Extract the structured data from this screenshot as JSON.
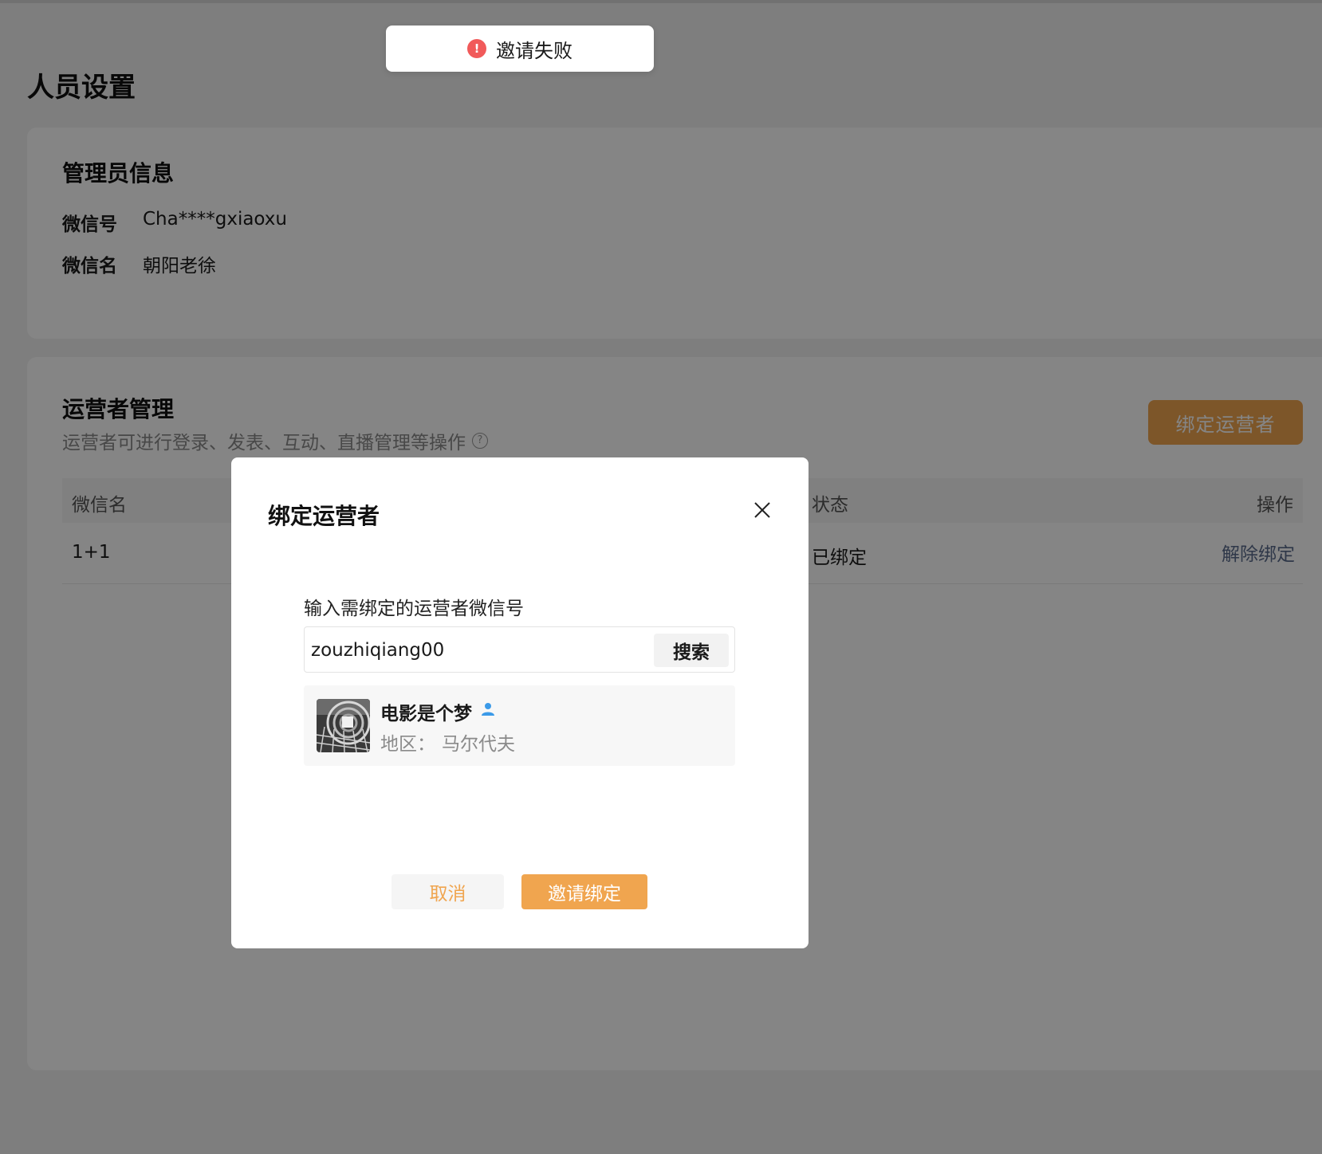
{
  "page": {
    "title": "人员设置"
  },
  "admin": {
    "section_title": "管理员信息",
    "wechat_id_label": "微信号",
    "wechat_id_value": "Cha****gxiaoxu",
    "wechat_name_label": "微信名",
    "wechat_name_value": "朝阳老徐"
  },
  "operators": {
    "section_title": "运营者管理",
    "subtitle": "运营者可进行登录、发表、互动、直播管理等操作",
    "bind_button": "绑定运营者",
    "table": {
      "headers": {
        "name": "微信名",
        "status": "状态",
        "actions": "操作"
      },
      "rows": [
        {
          "name": "1+1",
          "status": "已绑定",
          "action": "解除绑定"
        }
      ]
    }
  },
  "toast": {
    "message": "邀请失败",
    "icon": "error-icon",
    "color": "#f15a5a"
  },
  "dialog": {
    "title": "绑定运营者",
    "field_label": "输入需绑定的运营者微信号",
    "search": {
      "value": "zouzhiqiang00",
      "button": "搜索"
    },
    "result": {
      "name": "电影是个梦",
      "region_label": "地区：",
      "region_value": "马尔代夫"
    },
    "cancel_button": "取消",
    "invite_button": "邀请绑定"
  },
  "colors": {
    "accent": "#f0a54f",
    "link": "#5b6b8c",
    "error": "#f15a5a",
    "verified": "#3b9ae8"
  }
}
